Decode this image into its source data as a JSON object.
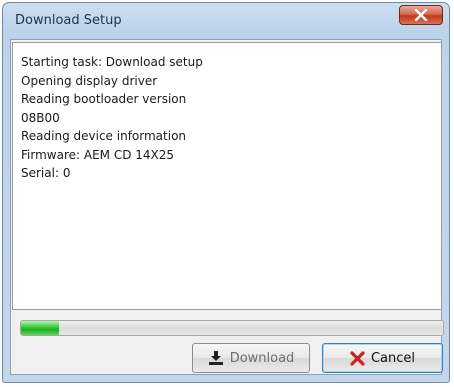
{
  "window": {
    "title": "Download Setup",
    "close_icon": "close-x-icon"
  },
  "log": {
    "lines": [
      "Starting task: Download setup",
      "Opening display driver",
      "Reading bootloader version",
      "08B00",
      "Reading device information",
      "Firmware: AEM CD 14X25",
      "Serial: 0"
    ]
  },
  "progress": {
    "fraction": 0.09,
    "color": "#2bbf2b"
  },
  "buttons": {
    "download": {
      "label": "Download",
      "icon": "download-icon",
      "enabled": false
    },
    "cancel": {
      "label": "Cancel",
      "icon": "red-x-icon",
      "enabled": true
    }
  },
  "colors": {
    "accent_red": "#cc1f1f",
    "progress_green": "#2bbf2b",
    "title_text": "#1e3450"
  }
}
